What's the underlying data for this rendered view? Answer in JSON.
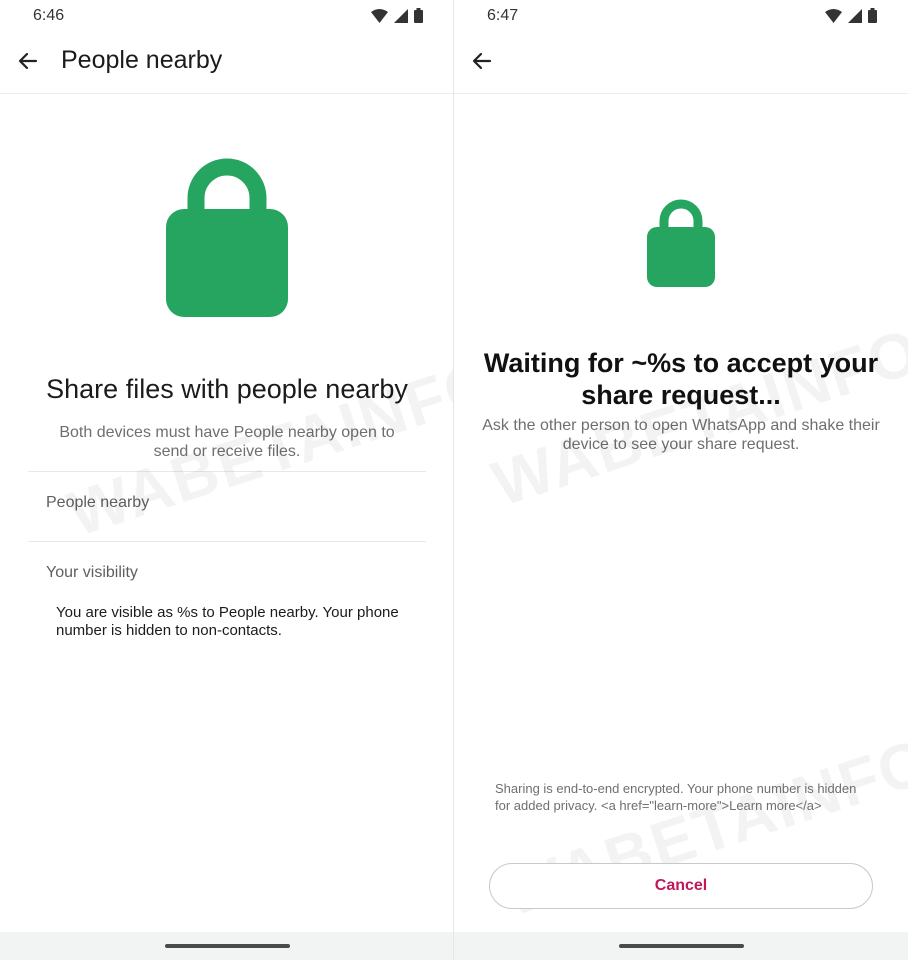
{
  "left_screen": {
    "status_time": "6:46",
    "title": "People nearby",
    "heading": "Share files with people nearby",
    "subtitle": "Both devices must have People nearby open to send or receive files.",
    "rows": [
      {
        "label": "People nearby"
      },
      {
        "label": "Your visibility"
      }
    ],
    "visibility_text": "You are visible as %s to People nearby. Your phone number is hidden to non-contacts.",
    "icons": [
      "wifi-icon",
      "cell-signal-icon",
      "battery-icon",
      "back-arrow-icon",
      "lock-icon"
    ]
  },
  "right_screen": {
    "status_time": "6:47",
    "heading": "Waiting for ~%s to accept your share request...",
    "subtitle": "Ask the other person to open WhatsApp and shake their device to see your share request.",
    "encryption_note": "Sharing is end-to-end encrypted. Your phone number is hidden for added privacy. <a href=\"learn-more\">Learn more</a>",
    "cancel_label": "Cancel"
  },
  "colors": {
    "lock_green": "#25A55F",
    "cancel_text": "#C2185B"
  },
  "watermark": "WABETAINFO"
}
